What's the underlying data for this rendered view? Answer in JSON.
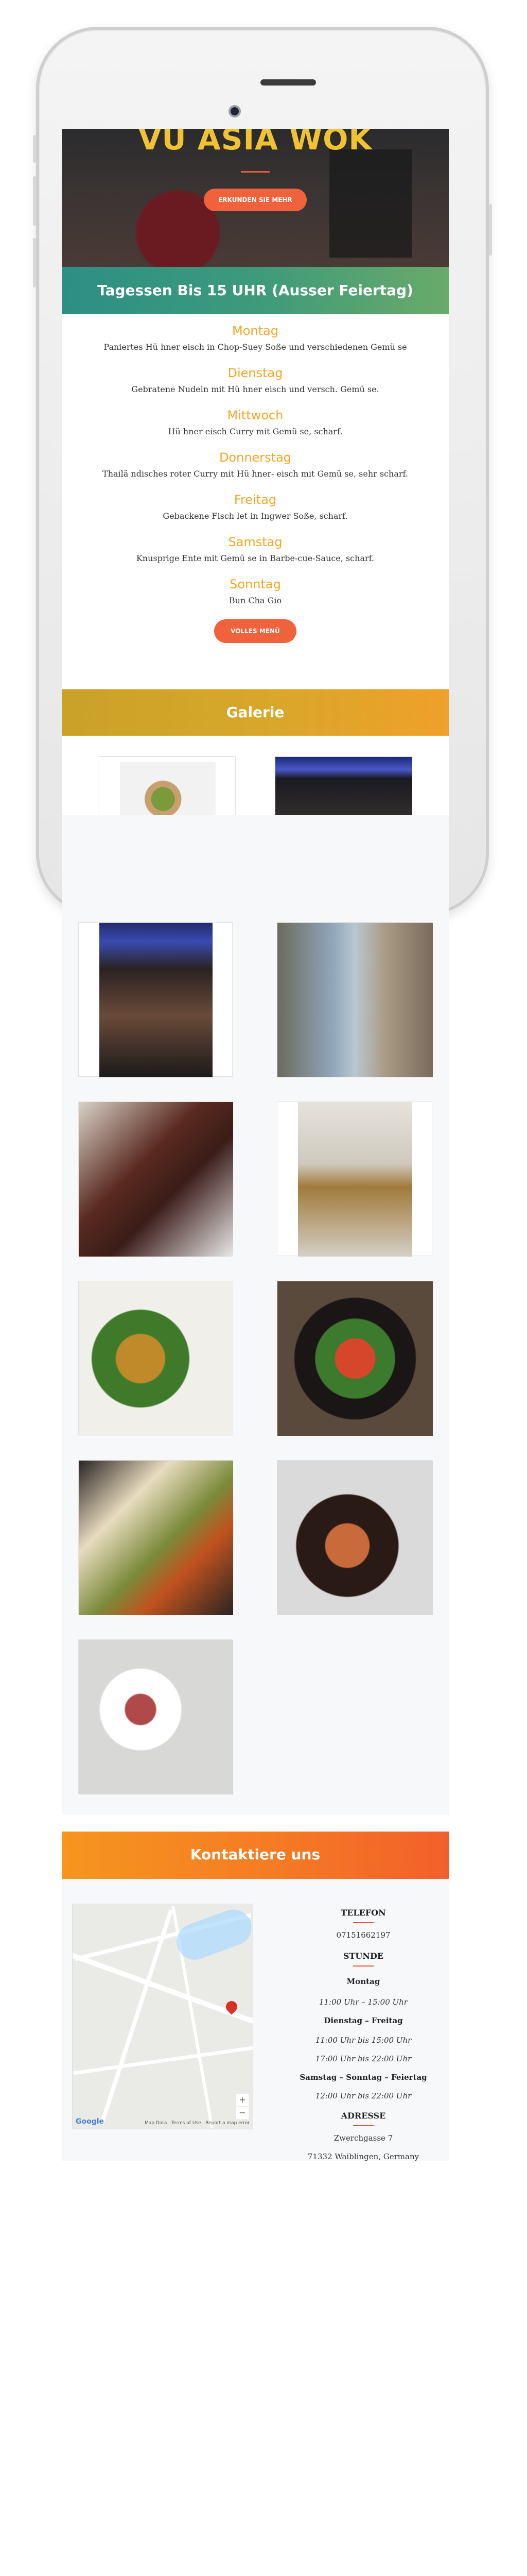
{
  "hero": {
    "title": "VU ASIA WOK",
    "button": "ERKUNDEN SIE MEHR"
  },
  "lunch": {
    "title": "Tagessen Bis 15 UHR (Ausser Feiertag)",
    "days": [
      {
        "day": "Montag",
        "dish": "Paniertes Hü hner eisch in Chop-Suey Soße und verschiedenen Gemü se"
      },
      {
        "day": "Dienstag",
        "dish": "Gebratene Nudeln mit Hü hner eisch und versch. Gemü se."
      },
      {
        "day": "Mittwoch",
        "dish": "Hü hner eisch Curry mit Gemü se, scharf."
      },
      {
        "day": "Donnerstag",
        "dish": "Thailä ndisches roter Curry mit Hü hner- eisch mit Gemü se, sehr scharf."
      },
      {
        "day": "Freitag",
        "dish": "Gebackene Fisch let in Ingwer Soße, scharf."
      },
      {
        "day": "Samstag",
        "dish": "Knusprige Ente mit Gemü se in Barbe-cue-Sauce, scharf."
      },
      {
        "day": "Sonntag",
        "dish": "Bun Cha Gio"
      }
    ],
    "button": "VOLLES MENÜ"
  },
  "gallery": {
    "title": "Galerie"
  },
  "contact": {
    "title": "Kontaktiere uns",
    "phone_label": "TELEFON",
    "phone": "07151662197",
    "hours_label": "STUNDE",
    "hours": [
      {
        "day": "Montag",
        "times": [
          "11:00 Uhr – 15:00 Uhr"
        ]
      },
      {
        "day": "Dienstag – Freitag",
        "times": [
          "11:00 Uhr bis 15:00 Uhr",
          "17:00 Uhr bis 22:00 Uhr"
        ]
      },
      {
        "day": "Samstag – Sonntag – Feiertag",
        "times": [
          "12:00 Uhr bis 22:00 Uhr"
        ]
      }
    ],
    "address_label": "ADRESSE",
    "address_line1": "Zwerchgasse 7",
    "address_line2": "71332 Waiblingen, Germany"
  },
  "map": {
    "brand": "Google",
    "footer": [
      "Map Data",
      "Terms of Use",
      "Report a map error"
    ],
    "zoom_in": "+",
    "zoom_out": "−",
    "marker_color": "#d93025"
  },
  "colors": {
    "accent": "#f0623c",
    "gold": "#f1c232",
    "day": "#f5a623",
    "teal": "#2d8f84"
  }
}
